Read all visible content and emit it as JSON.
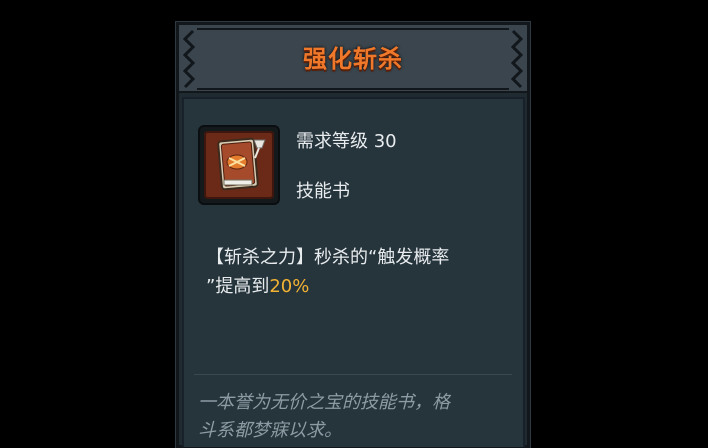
{
  "tooltip": {
    "title": "强化斩杀",
    "requirement": "需求等级 30",
    "item_type": "技能书",
    "description": {
      "line1": "【斩杀之力】秒杀的“触发概率",
      "line2_prefix": "”提高到",
      "value": "20%"
    },
    "flavor_text": {
      "line1": "一本誉为无价之宝的技能书，格",
      "line2": "斗系都梦寐以求。"
    },
    "icon": "skill-book-icon"
  },
  "colors": {
    "title": "#f0782a",
    "highlight": "#f2b233",
    "flavor": "#8d9ca4",
    "panel": "#26343c",
    "header": "#3a454d"
  }
}
